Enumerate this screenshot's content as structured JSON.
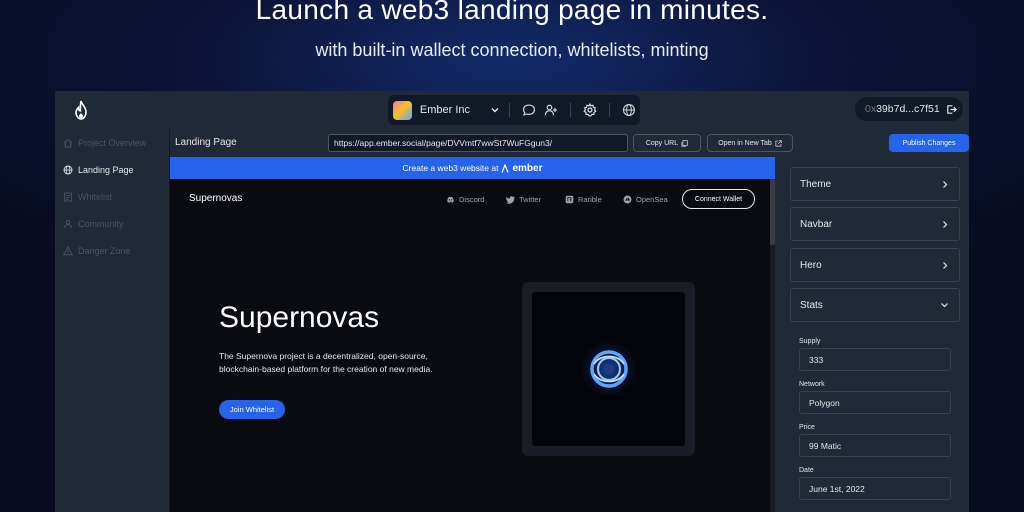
{
  "hero": {
    "headline": "Launch a web3 landing page in minutes.",
    "subline": "with built-in wallect connection, whitelists, minting"
  },
  "topbar": {
    "workspace_name": "Ember Inc",
    "wallet_prefix": "0x",
    "wallet_rest": "39b7d...c7f51"
  },
  "sidebar": {
    "items": [
      {
        "label": "Project Overview",
        "icon": "home-icon"
      },
      {
        "label": "Landing Page",
        "icon": "globe-icon",
        "active": true
      },
      {
        "label": "Whitelist",
        "icon": "list-icon"
      },
      {
        "label": "Community",
        "icon": "users-icon"
      },
      {
        "label": "Danger Zone",
        "icon": "warning-icon"
      }
    ]
  },
  "urlbar": {
    "page_label": "Landing Page",
    "url": "https://app.ember.social/page/DVVmtf7wwSt7WuFGgun3/",
    "copy_label": "Copy URL",
    "newtab_label": "Open in New Tab",
    "publish_label": "Publish Changes"
  },
  "preview": {
    "banner_text": "Create a web3 website at",
    "banner_brand": "ember",
    "site_name": "Supernovas",
    "links": [
      "Discord",
      "Twitter",
      "Rarible",
      "OpenSea"
    ],
    "connect_label": "Connect Wallet",
    "title": "Supernovas",
    "description": "The Supernova project is a decentralized, open-source, blockchain-based platform for the creation of new media.",
    "join_label": "Join Whitelist"
  },
  "panel": {
    "sections": [
      "Theme",
      "Navbar",
      "Hero",
      "Stats"
    ],
    "fields": [
      {
        "label": "Supply",
        "value": "333"
      },
      {
        "label": "Network",
        "value": "Polygon"
      },
      {
        "label": "Price",
        "value": "99 Matic"
      },
      {
        "label": "Date",
        "value": "June 1st, 2022"
      }
    ]
  },
  "colors": {
    "accent": "#2563eb",
    "active_indicator": "#22c55e",
    "app_bg": "#1f2937",
    "dark_bg": "#111827"
  }
}
